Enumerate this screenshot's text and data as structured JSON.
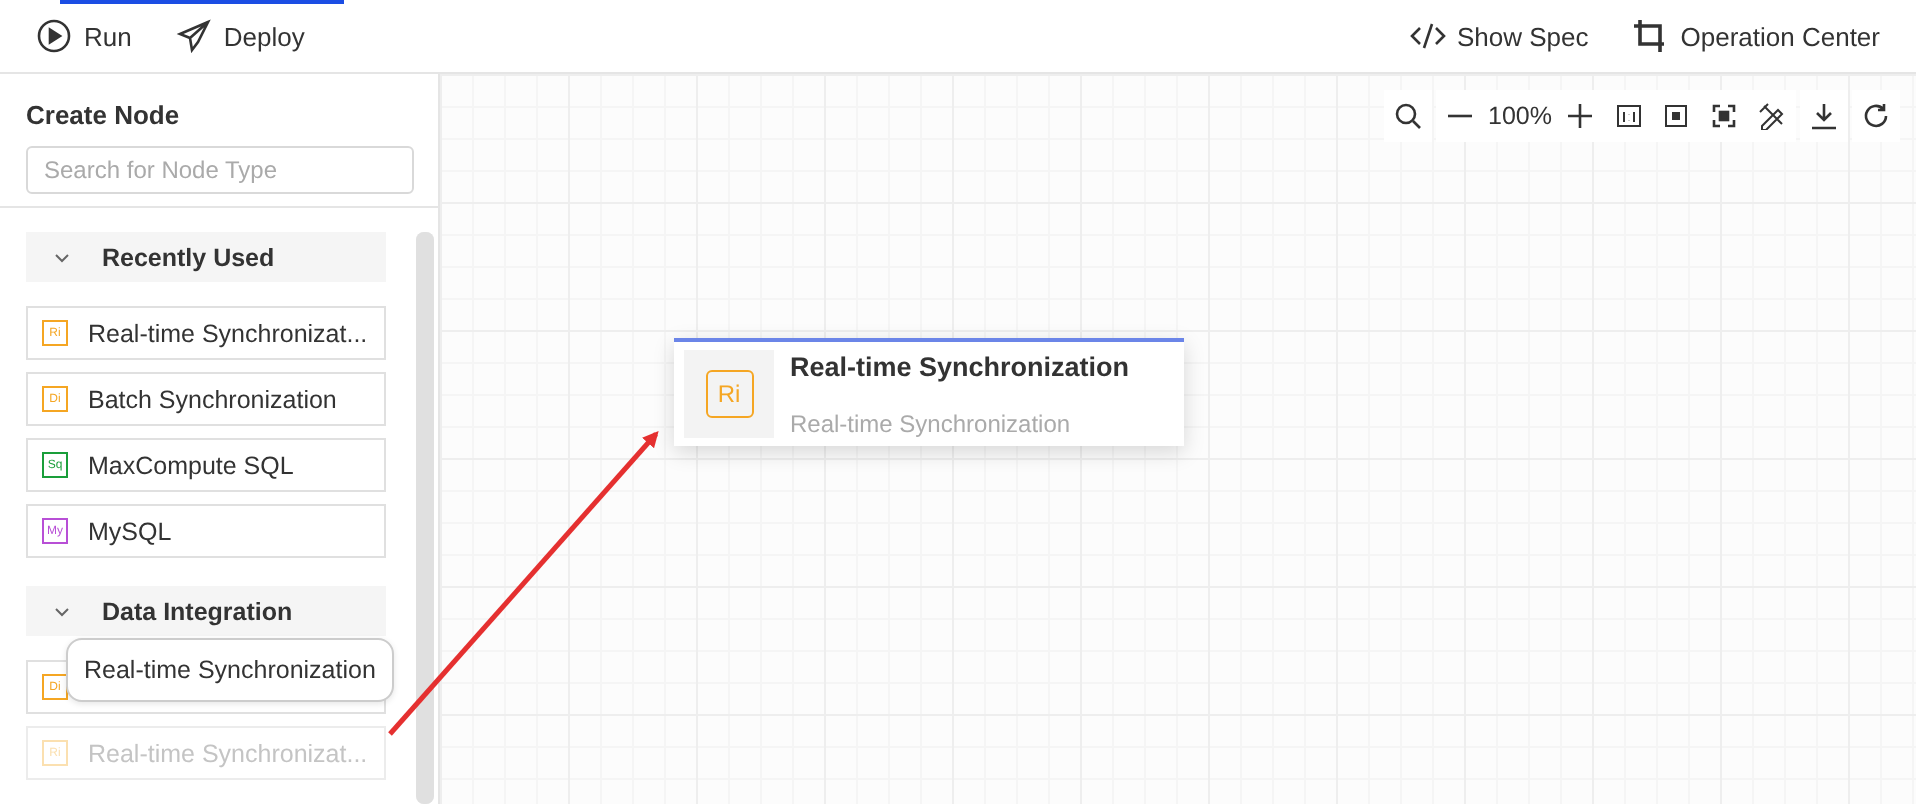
{
  "toolbar": {
    "left": [
      {
        "kind": "run",
        "label": "Run"
      },
      {
        "kind": "deploy",
        "label": "Deploy"
      }
    ],
    "right": [
      {
        "kind": "code",
        "label": "Show Spec"
      },
      {
        "kind": "crop",
        "label": "Operation Center"
      }
    ]
  },
  "sidebar": {
    "title": "Create Node",
    "search": {
      "placeholder": "Search for Node Type"
    },
    "groups": [
      {
        "title": "Recently Used",
        "expanded": true,
        "items": [
          {
            "icon": "Ri",
            "color": "#f5a623",
            "label": "Real-time Synchronizat...",
            "dragging": false
          },
          {
            "icon": "Di",
            "color": "#f5a623",
            "label": "Batch Synchronization",
            "dragging": false
          },
          {
            "icon": "Sq",
            "color": "#1a9e3a",
            "label": "MaxCompute SQL",
            "dragging": false
          },
          {
            "icon": "My",
            "color": "#b84fd6",
            "label": "MySQL",
            "dragging": false
          }
        ]
      },
      {
        "title": "Data Integration",
        "expanded": true,
        "items": [
          {
            "icon": "Di",
            "color": "#f5a623",
            "dragging": false
          },
          {
            "icon": "Ri",
            "color": "#fbe0b0",
            "label": "Real-time Synchronizat...",
            "dragging": true
          }
        ]
      }
    ],
    "tooltip": "Real-time Synchronization"
  },
  "canvas": {
    "zoom": "100%",
    "node": {
      "icon": "Ri",
      "color": "#f5a623",
      "title": "Real-time Synchronization",
      "subtitle": "Real-time Synchronization"
    }
  }
}
